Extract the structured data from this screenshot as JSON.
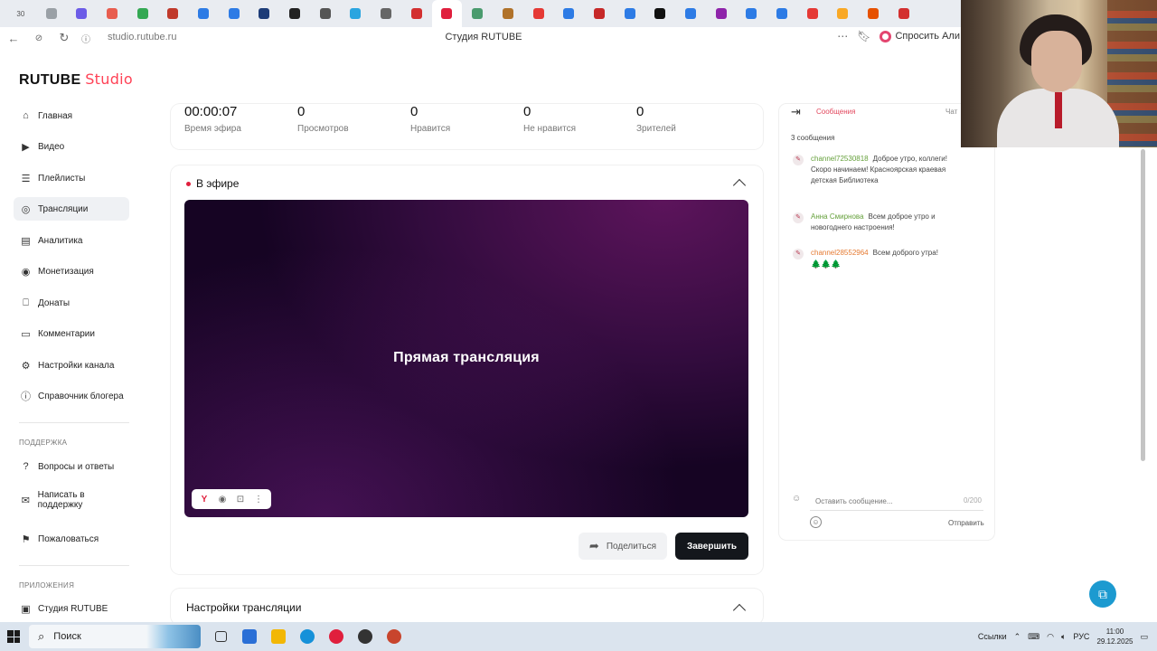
{
  "browser": {
    "tabs": [
      {
        "label": "30",
        "color": "#9aa0a6"
      },
      {
        "label": "",
        "color": "#9aa0a6"
      },
      {
        "label": "",
        "color": "#6c5ce7"
      },
      {
        "label": "",
        "color": "#e85d4f"
      },
      {
        "label": "",
        "color": "#34a853"
      },
      {
        "label": "",
        "color": "#c0392b"
      },
      {
        "label": "",
        "color": "#2d7be5"
      },
      {
        "label": "",
        "color": "#2d7be5"
      },
      {
        "label": "",
        "color": "#1d3c78"
      },
      {
        "label": "",
        "color": "#222222"
      },
      {
        "label": "",
        "color": "#555555"
      },
      {
        "label": "",
        "color": "#2aa5e0"
      },
      {
        "label": "",
        "color": "#666666"
      },
      {
        "label": "",
        "color": "#d32f2f"
      },
      {
        "label": "",
        "color": "#e01f3d"
      },
      {
        "label": "",
        "color": "#4a9b6e"
      },
      {
        "label": "",
        "color": "#b0722a"
      },
      {
        "label": "",
        "color": "#e53935"
      },
      {
        "label": "",
        "color": "#2d7be5"
      },
      {
        "label": "",
        "color": "#c62828"
      },
      {
        "label": "",
        "color": "#2d7be5"
      },
      {
        "label": "",
        "color": "#111111"
      },
      {
        "label": "",
        "color": "#2d7be5"
      },
      {
        "label": "",
        "color": "#8e24aa"
      },
      {
        "label": "",
        "color": "#2d7be5"
      },
      {
        "label": "",
        "color": "#2d7be5"
      },
      {
        "label": "",
        "color": "#e53935"
      },
      {
        "label": "",
        "color": "#f9a825"
      },
      {
        "label": "",
        "color": "#e65100"
      },
      {
        "label": "",
        "color": "#d32f2f"
      }
    ],
    "active_tab_index": 14,
    "url": "studio.rutube.ru",
    "page_title": "Студия RUTUBE",
    "ask_alice": "Спросить Али"
  },
  "app": {
    "logo_main": "RUTUBE",
    "logo_studio": "Studio"
  },
  "sidebar": {
    "items": [
      {
        "label": "Главная",
        "icon": "home-icon"
      },
      {
        "label": "Видео",
        "icon": "play-circle-icon"
      },
      {
        "label": "Плейлисты",
        "icon": "playlist-icon"
      },
      {
        "label": "Трансляции",
        "icon": "broadcast-icon"
      },
      {
        "label": "Аналитика",
        "icon": "analytics-icon"
      },
      {
        "label": "Монетизация",
        "icon": "coin-icon"
      },
      {
        "label": "Донаты",
        "icon": "gift-icon"
      },
      {
        "label": "Комментарии",
        "icon": "comment-icon"
      },
      {
        "label": "Настройки канала",
        "icon": "gear-icon"
      },
      {
        "label": "Справочник блогера",
        "icon": "info-icon"
      }
    ],
    "support_heading": "ПОДДЕРЖКА",
    "support_items": [
      {
        "label": "Вопросы и ответы",
        "icon": "question-icon"
      },
      {
        "label": "Написать в поддержку",
        "icon": "mail-icon"
      },
      {
        "label": "Пожаловаться",
        "icon": "flag-icon"
      }
    ],
    "apps_heading": "ПРИЛОЖЕНИЯ",
    "apps_items": [
      {
        "label": "Студия RUTUBE",
        "icon": "app-icon"
      }
    ]
  },
  "stats": [
    {
      "value": "00:00:07",
      "label": "Время эфира"
    },
    {
      "value": "0",
      "label": "Просмотров"
    },
    {
      "value": "0",
      "label": "Нравится"
    },
    {
      "value": "0",
      "label": "Не нравится"
    },
    {
      "value": "0",
      "label": "Зрителей"
    }
  ],
  "live": {
    "header": "В эфире",
    "player_title": "Прямая трансляция",
    "share_label": "Поделиться",
    "finish_label": "Завершить"
  },
  "settings": {
    "title": "Настройки трансляции"
  },
  "chat": {
    "tab_messages": "Сообщения",
    "tab_chat": "Чат",
    "count": "3 сообщения",
    "messages": [
      {
        "author": "channel72530818",
        "text": "Доброе утро, коллеги! Скоро начинаем! Красноярская краевая детская Библиотека",
        "color": "#66a13c"
      },
      {
        "author": "Анна Смирнова",
        "text": "Всем доброе утро и новогоднего настроения!",
        "color": "#66a13c"
      },
      {
        "author": "channel28552964",
        "text": "Всем доброго утра!",
        "extra": "🌲🌲🌲",
        "color": "#e57a31"
      }
    ],
    "input_placeholder": "Оставить сообщение...",
    "counter": "0/200",
    "send_label": "Отправить"
  },
  "taskbar": {
    "search_label": "Поиск",
    "apps": [
      {
        "name": "task-view",
        "color": "#333333"
      },
      {
        "name": "app-blue",
        "color": "#2a6fd6"
      },
      {
        "name": "file-explorer",
        "color": "#f2b705"
      },
      {
        "name": "edge",
        "color": "#1591d9"
      },
      {
        "name": "yandex-browser",
        "color": "#e01f3d"
      },
      {
        "name": "obs",
        "color": "#333333"
      },
      {
        "name": "powerpoint",
        "color": "#c8452d"
      }
    ],
    "tray_links": "Ссылки",
    "lang": "РУС",
    "time": "11:00",
    "date": "29.12.2025"
  }
}
